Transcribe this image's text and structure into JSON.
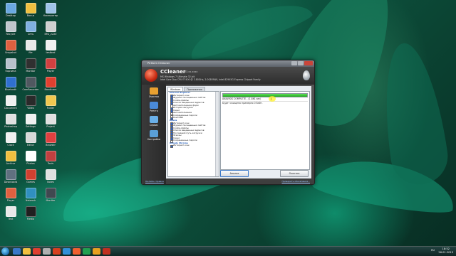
{
  "desktop": {
    "icons": [
      {
        "label": "Desktop",
        "color": "#6aa8e0"
      },
      {
        "label": "Bonus",
        "color": "#f0c040"
      },
      {
        "label": "Компьютер",
        "color": "#9fc3e8"
      },
      {
        "label": "Recycle",
        "color": "#c0c6cc"
      },
      {
        "label": "Сеть",
        "color": "#80b0e0"
      },
      {
        "label": "IMG_2220",
        "color": "#d0d0d0"
      },
      {
        "label": "Snapshot",
        "color": "#e06040"
      },
      {
        "label": "file",
        "color": "#e8e8e8"
      },
      {
        "label": "testbed",
        "color": "#f0f0f0"
      },
      {
        "label": "Корзина",
        "color": "#b8c2cc"
      },
      {
        "label": "Monitor",
        "color": "#303030"
      },
      {
        "label": "Player",
        "color": "#d04040"
      },
      {
        "label": "Bluetooth",
        "color": "#3070d0"
      },
      {
        "label": "CamRecorder",
        "color": "#505860"
      },
      {
        "label": "Bandicam",
        "color": "#e04030"
      },
      {
        "label": "Document",
        "color": "#f0f0f0"
      },
      {
        "label": "Video",
        "color": "#2a2a2a"
      },
      {
        "label": "Folder",
        "color": "#f0c850"
      },
      {
        "label": "Photoshop",
        "color": "#e0e0e0"
      },
      {
        "label": "Settings",
        "color": "#f0f0f0"
      },
      {
        "label": "Project",
        "color": "#e0e0e0"
      },
      {
        "label": "Clock",
        "color": "#f0f0f0"
      },
      {
        "label": "Editor",
        "color": "#d8d8d8"
      },
      {
        "label": "Browser",
        "color": "#e04040"
      },
      {
        "label": "Archive",
        "color": "#f0c040"
      },
      {
        "label": "Photos",
        "color": "#ffffff"
      },
      {
        "label": "Tools",
        "color": "#c04040"
      },
      {
        "label": "Downloads",
        "color": "#607080"
      },
      {
        "label": "Games",
        "color": "#d04030"
      },
      {
        "label": "Notes",
        "color": "#e0e0e0"
      },
      {
        "label": "Player",
        "color": "#e06040"
      },
      {
        "label": "Network",
        "color": "#3090c0"
      },
      {
        "label": "Monitor",
        "color": "#404850"
      },
      {
        "label": "Text",
        "color": "#e8e8e8"
      },
      {
        "label": "Media",
        "color": "#202020"
      }
    ]
  },
  "window": {
    "title": "Piriform CCleaner",
    "app_name": "CCleaner",
    "app_version": "v3.xx.xxxx",
    "sysinfo_line1": "MS Windows 7 Ultimate 32-bit",
    "sysinfo_line2": "Intel Core Duo CPU E7400 @ 2.80GHz, 2.0GB RAM, Intel 82945G Express Chipset Family"
  },
  "sidebar": [
    {
      "label": "Очистка",
      "color": "#e8a030"
    },
    {
      "label": "Реестр",
      "color": "#4a8ad8"
    },
    {
      "label": "Сервис",
      "color": "#6ab0e8"
    },
    {
      "label": "Настройки",
      "color": "#5aa0d8"
    }
  ],
  "tabs": [
    {
      "label": "Windows"
    },
    {
      "label": "Приложения"
    }
  ],
  "tree": [
    {
      "text": "Internet Explorer",
      "head": true
    },
    {
      "text": "Интернет-кэш",
      "on": true
    },
    {
      "text": "Журнал посещенных сайтов",
      "on": true
    },
    {
      "text": "Cookie-файлы",
      "on": true
    },
    {
      "text": "Список введенных адресов",
      "on": true
    },
    {
      "text": "Автозаполнение форм",
      "on": false
    },
    {
      "text": "История загрузок",
      "on": true
    },
    {
      "text": "Сеанс",
      "on": true
    },
    {
      "text": "Автозаполнение",
      "on": false
    },
    {
      "text": "Сохраненные пароли",
      "on": false
    },
    {
      "text": "Кэш DNS",
      "on": true
    },
    {
      "text": "Opera",
      "head": true
    },
    {
      "text": "Интернет-кэш",
      "on": true
    },
    {
      "text": "Журнал посещенных сайтов",
      "on": true
    },
    {
      "text": "Cookie-файлы",
      "on": true
    },
    {
      "text": "Список введенных адресов",
      "on": true
    },
    {
      "text": "Последний путь загрузки",
      "on": true
    },
    {
      "text": "Эскизы",
      "on": true
    },
    {
      "text": "Сеанс",
      "on": true
    },
    {
      "text": "Сохраненные пароли",
      "on": false
    },
    {
      "text": "Google Chrome",
      "head": true
    },
    {
      "text": "Интернет-кэш",
      "on": true
    }
  ],
  "results": {
    "progress": 1.0,
    "status": "ANALYSIS COMPLETE - (1.861 sec)",
    "note": "Будет очищено примерно 0 байт."
  },
  "buttons": {
    "analyze": "Анализ",
    "clean": "Очистка"
  },
  "footer": {
    "help": "Онлайн-справка",
    "update": "Проверить обновления..."
  },
  "taskbar": {
    "icons": [
      "#3a78c8",
      "#f0c040",
      "#e04030",
      "#b0b0b0",
      "#d84020",
      "#3090d8",
      "#f06030",
      "#20a050",
      "#e8a020",
      "#c03020"
    ],
    "lang": "RU",
    "time": "18:52",
    "date": "26.01.2013"
  }
}
